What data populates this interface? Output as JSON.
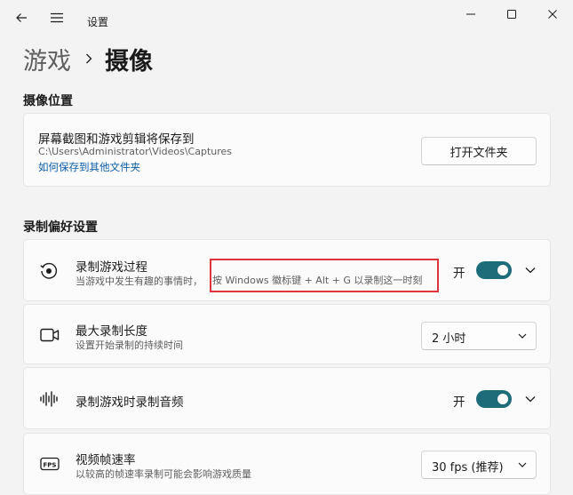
{
  "window": {
    "app_title": "设置",
    "back_icon": "back-arrow-icon",
    "menu_icon": "hamburger-menu-icon",
    "minimize_icon": "minimize-icon",
    "maximize_icon": "maximize-icon",
    "close_icon": "close-icon"
  },
  "breadcrumb": {
    "parent": "游戏",
    "separator_icon": "chevron-right-icon",
    "current": "摄像"
  },
  "capture_location": {
    "section_title": "摄像位置",
    "title": "屏幕截图和游戏剪辑将保存到",
    "path": "C:\\Users\\Administrator\\Videos\\Captures",
    "link": "如何保存到其他文件夹",
    "button": "打开文件夹"
  },
  "recording_prefs": {
    "section_title": "录制偏好设置",
    "items": [
      {
        "icon": "record-what-happened-icon",
        "title": "录制游戏过程",
        "desc_prefix": "当游戏中发生有趣的事情时，",
        "desc_highlight": "按 Windows 徽标键 + Alt + G 以录制这一时刻",
        "toggle_label": "开",
        "toggle_on": true,
        "expander_icon": "chevron-down-icon"
      },
      {
        "icon": "camcorder-icon",
        "title": "最大录制长度",
        "desc": "设置开始录制的持续时间",
        "combo_value": "2 小时",
        "combo_icon": "chevron-down-icon"
      },
      {
        "icon": "audio-waveform-icon",
        "title": "录制游戏时录制音频",
        "toggle_label": "开",
        "toggle_on": true,
        "expander_icon": "chevron-down-icon"
      },
      {
        "icon": "fps-icon",
        "title": "视频帧速率",
        "desc": "以较高的帧速率录制可能会影响游戏质量",
        "combo_value": "30 fps (推荐)",
        "combo_icon": "chevron-down-icon"
      }
    ]
  },
  "colors": {
    "accent": "#1e6b7a",
    "link": "#0b5cab",
    "highlight_box": "#e0353b",
    "background": "#f3f3f3",
    "card": "#fbfbfb"
  }
}
